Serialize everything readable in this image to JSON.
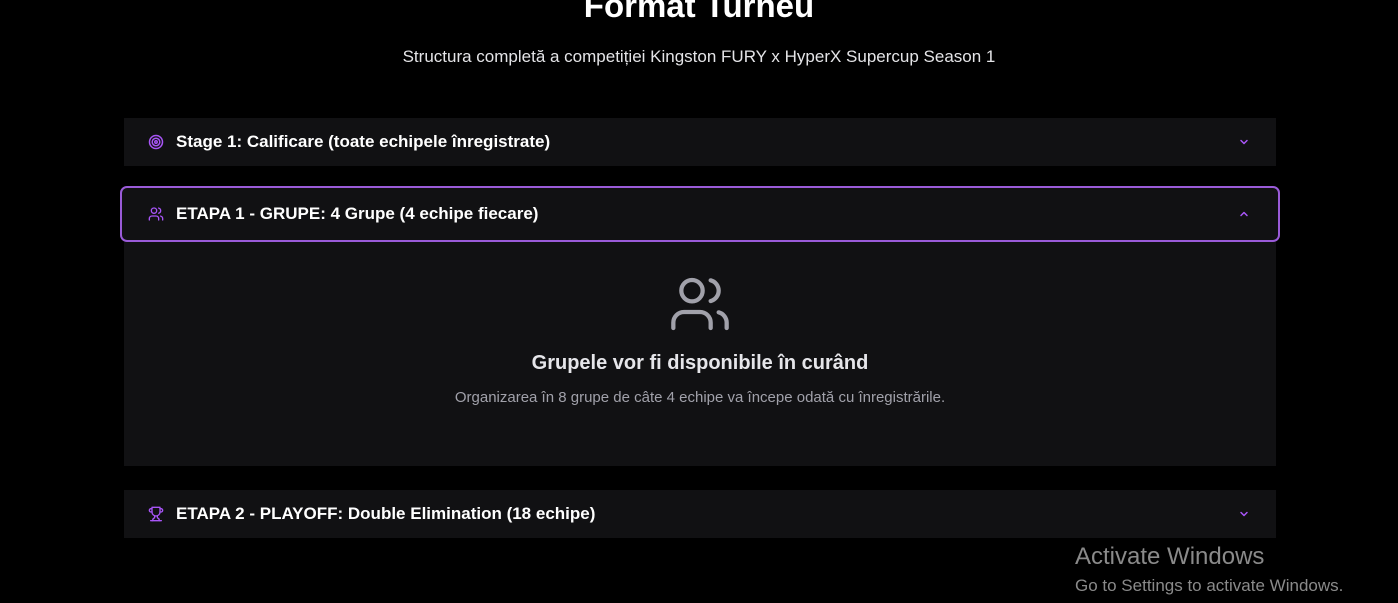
{
  "header": {
    "title": "Format Turneu",
    "subtitle": "Structura completă a competiției Kingston FURY x HyperX Supercup Season 1"
  },
  "accordions": [
    {
      "label": "Stage 1: Calificare (toate echipele înregistrate)",
      "icon": "target-icon",
      "expanded": false
    },
    {
      "label": "ETAPA 1 - GRUPE: 4 Grupe (4 echipe fiecare)",
      "icon": "users-icon",
      "expanded": true,
      "content": {
        "icon": "users-icon",
        "title": "Grupele vor fi disponibile în curând",
        "description": "Organizarea în 8 grupe de câte 4 echipe va începe odată cu înregistrările."
      }
    },
    {
      "label": "ETAPA 2 - PLAYOFF: Double Elimination (18 echipe)",
      "icon": "trophy-icon",
      "expanded": false
    }
  ],
  "watermark": {
    "title": "Activate Windows",
    "subtitle": "Go to Settings to activate Windows."
  },
  "colors": {
    "background": "#000000",
    "card": "#111113",
    "accent": "#9a5bd8",
    "icon_accent": "#a855f7",
    "muted_text": "#a1a1aa"
  }
}
